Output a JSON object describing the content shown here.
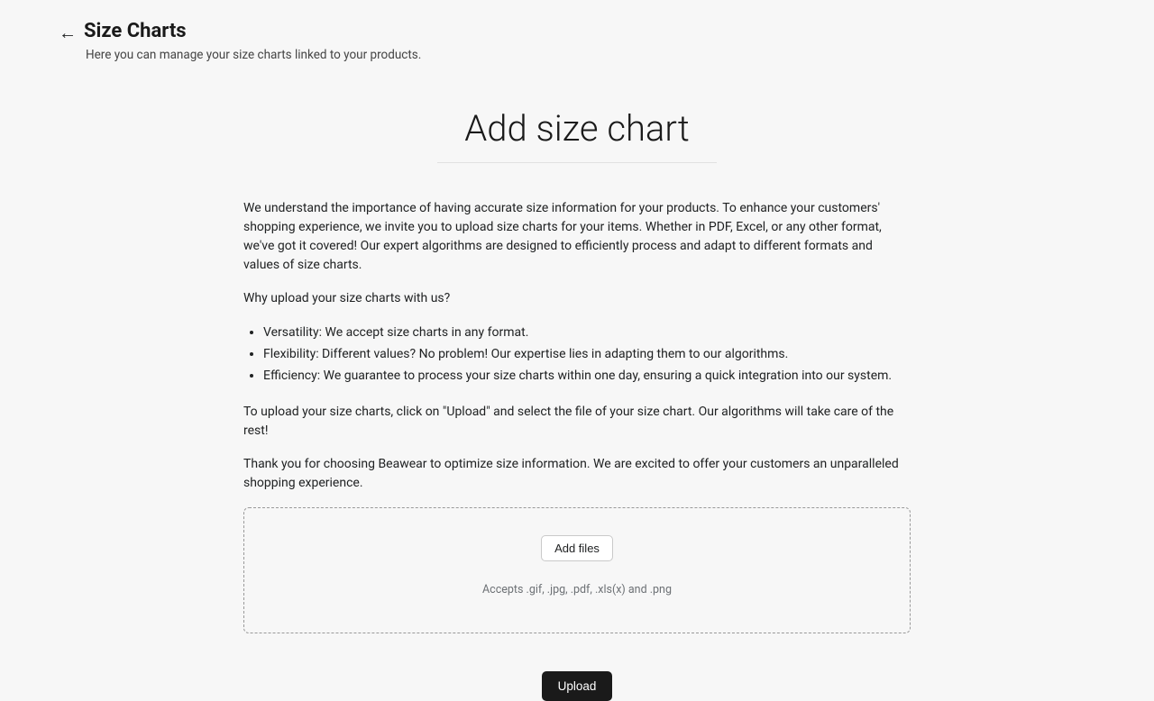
{
  "header": {
    "title": "Size Charts",
    "subtitle": "Here you can manage your size charts linked to your products."
  },
  "main": {
    "title": "Add size chart",
    "intro": "We understand the importance of having accurate size information for your products. To enhance your customers' shopping experience, we invite you to upload size charts for your items. Whether in PDF, Excel, or any other format, we've got it covered! Our expert algorithms are designed to efficiently process and adapt to different formats and values of size charts.",
    "why_heading": "Why upload your size charts with us?",
    "bullets": [
      "Versatility: We accept size charts in any format.",
      "Flexibility: Different values? No problem! Our expertise lies in adapting them to our algorithms.",
      "Efficiency: We guarantee to process your size charts within one day, ensuring a quick integration into our system."
    ],
    "howto": "To upload your size charts, click on \"Upload\" and select the file of your size chart. Our algorithms will take care of the rest!",
    "thanks": "Thank you for choosing Beawear to optimize size information. We are excited to offer your customers an unparalleled shopping experience.",
    "dropzone": {
      "add_files_label": "Add files",
      "accepts_text": "Accepts .gif, .jpg, .pdf, .xls(x) and .png"
    },
    "upload_button": "Upload"
  }
}
